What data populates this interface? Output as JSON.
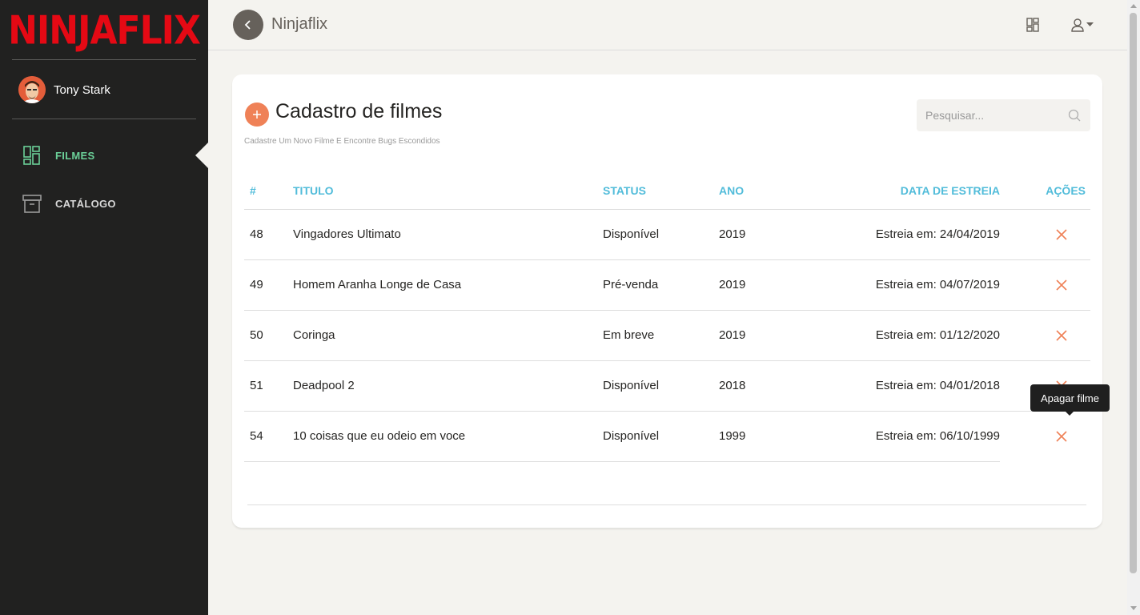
{
  "brand": {
    "logo_text": "NINJAFLIX"
  },
  "user": {
    "name": "Tony Stark"
  },
  "sidebar": {
    "items": [
      {
        "label": "FILMES",
        "icon": "dashboard-icon",
        "active": true
      },
      {
        "label": "CATÁLOGO",
        "icon": "archive-icon",
        "active": false
      }
    ]
  },
  "header": {
    "title": "Ninjaflix"
  },
  "card": {
    "title": "Cadastro de filmes",
    "subtitle": "Cadastre Um Novo Filme E Encontre Bugs Escondidos"
  },
  "search": {
    "placeholder": "Pesquisar...",
    "value": ""
  },
  "table": {
    "columns": [
      "#",
      "TITULO",
      "STATUS",
      "ANO",
      "DATA DE ESTREIA",
      "AÇÕES"
    ],
    "rows": [
      {
        "id": "48",
        "title": "Vingadores Ultimato",
        "status": "Disponível",
        "year": "2019",
        "release": "Estreia em: 24/04/2019"
      },
      {
        "id": "49",
        "title": "Homem Aranha Longe de Casa",
        "status": "Pré-venda",
        "year": "2019",
        "release": "Estreia em: 04/07/2019"
      },
      {
        "id": "50",
        "title": "Coringa",
        "status": "Em breve",
        "year": "2019",
        "release": "Estreia em: 01/12/2020"
      },
      {
        "id": "51",
        "title": "Deadpool 2",
        "status": "Disponível",
        "year": "2018",
        "release": "Estreia em: 04/01/2018"
      },
      {
        "id": "54",
        "title": "10 coisas que eu odeio em voce",
        "status": "Disponível",
        "year": "1999",
        "release": "Estreia em: 06/10/1999"
      }
    ]
  },
  "tooltip": {
    "text": "Apagar filme"
  },
  "colors": {
    "sidebar_bg": "#212120",
    "active_nav": "#6bd098",
    "table_header": "#51bcda",
    "add_button": "#ef8157",
    "delete_icon": "#ef8157",
    "logo": "#e50914"
  }
}
